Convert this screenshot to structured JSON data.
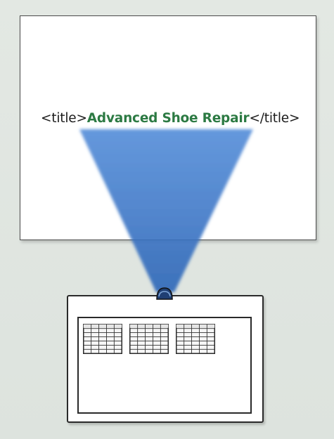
{
  "document": {
    "code_open": "<title>",
    "title_text": "Advanced Shoe Repair",
    "code_close": "</title>"
  },
  "colors": {
    "title_green": "#2c7a43",
    "beam_blue": "#3d78c9",
    "outline": "#2a2a2a"
  },
  "browser": {
    "table_count": 3,
    "table_rows": 5,
    "table_cols": 5
  }
}
